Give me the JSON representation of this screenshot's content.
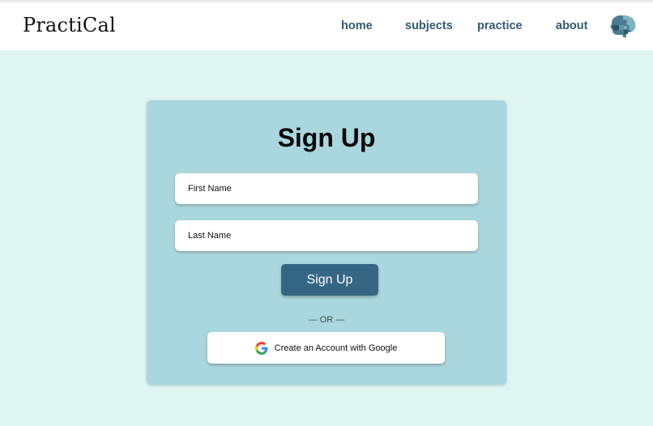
{
  "header": {
    "logo": "PractiCal",
    "nav": {
      "home": "home",
      "subjects": "subjects",
      "practice": "practice",
      "about": "about"
    },
    "avatar_icon": "puzzle-brain-icon"
  },
  "form": {
    "title": "Sign Up",
    "first_name_placeholder": "First Name",
    "last_name_placeholder": "Last Name",
    "submit_label": "Sign Up",
    "separator": "— OR —",
    "google_label": "Create an Account with Google",
    "google_icon": "google-icon"
  },
  "colors": {
    "page_bg": "#def5f1",
    "card_bg": "#aad7dd",
    "nav_text": "#2f5a74",
    "primary_button": "#356683"
  }
}
